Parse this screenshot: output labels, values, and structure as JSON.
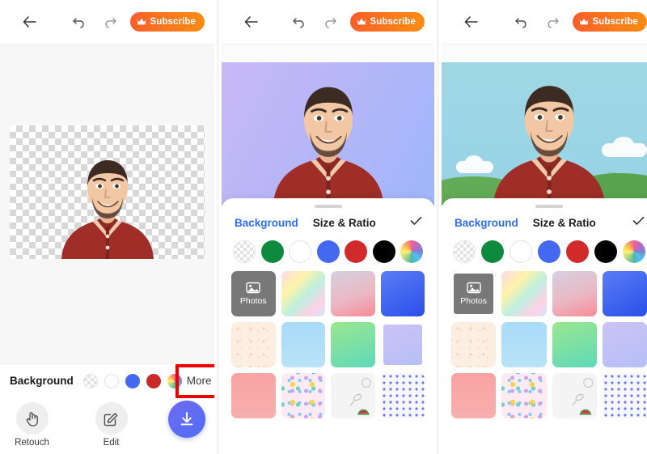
{
  "app": {
    "topbar": {
      "back_icon": "arrow-left-icon",
      "undo_icon": "undo-icon",
      "redo_icon": "redo-icon",
      "subscribe_label": "Subscribe",
      "subscribe_icon": "crown-icon",
      "subscribe_color": "#fb5d29"
    }
  },
  "panel1": {
    "name": "transparent-background-result",
    "background_bar": {
      "label": "Background",
      "more_label": "More",
      "more_highlighted": true,
      "highlight_color": "#ef0000",
      "swatches": [
        {
          "name": "transparent",
          "type": "checker"
        },
        {
          "name": "white",
          "color": "#ffffff"
        },
        {
          "name": "blue",
          "color": "#4469f0"
        },
        {
          "name": "red",
          "color": "#c92a2a"
        },
        {
          "name": "color-wheel",
          "type": "wheel"
        }
      ]
    },
    "actions": [
      {
        "name": "retouch",
        "label": "Retouch",
        "icon": "hand-pointer-icon"
      },
      {
        "name": "edit",
        "label": "Edit",
        "icon": "pencil-square-icon"
      }
    ],
    "download": {
      "name": "download-button",
      "icon": "download-icon",
      "color": "#5468f2"
    }
  },
  "panel2": {
    "name": "purple-gradient-background-applied",
    "sheet": {
      "tabs": [
        {
          "label": "Background",
          "active": true
        },
        {
          "label": "Size & Ratio",
          "active": false
        }
      ],
      "confirm_icon": "check-icon",
      "swatches": [
        {
          "name": "transparent",
          "type": "checker"
        },
        {
          "name": "green",
          "color": "#0d8a3e"
        },
        {
          "name": "white",
          "color": "#ffffff"
        },
        {
          "name": "blue",
          "color": "#4469f0"
        },
        {
          "name": "red",
          "color": "#d12a2a"
        },
        {
          "name": "black",
          "color": "#000000"
        },
        {
          "name": "color-wheel",
          "type": "wheel"
        }
      ],
      "grid": [
        {
          "name": "photos",
          "label": "Photos",
          "icon": "image-icon",
          "kind": "photos",
          "highlighted": false
        },
        {
          "name": "pastel-rainbow",
          "kind": "gradient",
          "css": "linear-gradient(135deg,#ffd9e8 0%,#fff3a8 30%,#bdf0df 55%,#ffd1e6 80%,#cfe9ff 100%)"
        },
        {
          "name": "mauve-pink",
          "kind": "gradient",
          "css": "linear-gradient(160deg,#d6cfe0 0%,#e9b9c4 55%,#f98a96 100%)"
        },
        {
          "name": "royal-blue",
          "kind": "gradient",
          "css": "linear-gradient(150deg,#5b7df7 0%,#2a4fe8 100%)"
        },
        {
          "name": "cream-pattern",
          "kind": "pattern-cream"
        },
        {
          "name": "sky-blue",
          "kind": "gradient",
          "css": "linear-gradient(180deg,#a9dbf8 0%,#b9e3f8 100%)"
        },
        {
          "name": "green-mint",
          "kind": "gradient",
          "css": "linear-gradient(160deg,#9ae78f 0%,#5fd9b9 100%)"
        },
        {
          "name": "lavender-blue",
          "kind": "gradient",
          "css": "linear-gradient(160deg,#cbc3f5 0%,#b6bff6 100%)",
          "highlighted": true
        },
        {
          "name": "coral-pink",
          "kind": "gradient",
          "css": "linear-gradient(180deg,#f9a3a3 0%,#f6b0ad 100%)"
        },
        {
          "name": "confetti-dots",
          "kind": "pattern-dots"
        },
        {
          "name": "watermelon-doodle",
          "kind": "pattern-doodle"
        },
        {
          "name": "blue-dot-grid",
          "kind": "pattern-bluedots"
        }
      ]
    }
  },
  "panel3": {
    "name": "custom-photo-background-applied",
    "sheet": {
      "tabs": [
        {
          "label": "Background",
          "active": true
        },
        {
          "label": "Size & Ratio",
          "active": false
        }
      ],
      "confirm_icon": "check-icon",
      "swatches": [
        {
          "name": "transparent",
          "type": "checker"
        },
        {
          "name": "green",
          "color": "#0d8a3e"
        },
        {
          "name": "white",
          "color": "#ffffff"
        },
        {
          "name": "blue",
          "color": "#4469f0"
        },
        {
          "name": "red",
          "color": "#d12a2a"
        },
        {
          "name": "black",
          "color": "#000000"
        },
        {
          "name": "color-wheel",
          "type": "wheel"
        }
      ],
      "grid": [
        {
          "name": "photos",
          "label": "Photos",
          "icon": "image-icon",
          "kind": "photos",
          "highlighted": true
        },
        {
          "name": "pastel-rainbow",
          "kind": "gradient",
          "css": "linear-gradient(135deg,#ffd9e8 0%,#fff3a8 30%,#bdf0df 55%,#ffd1e6 80%,#cfe9ff 100%)"
        },
        {
          "name": "mauve-pink",
          "kind": "gradient",
          "css": "linear-gradient(160deg,#d6cfe0 0%,#e9b9c4 55%,#f98a96 100%)"
        },
        {
          "name": "royal-blue",
          "kind": "gradient",
          "css": "linear-gradient(150deg,#5b7df7 0%,#2a4fe8 100%)"
        },
        {
          "name": "cream-pattern",
          "kind": "pattern-cream"
        },
        {
          "name": "sky-blue",
          "kind": "gradient",
          "css": "linear-gradient(180deg,#a9dbf8 0%,#b9e3f8 100%)"
        },
        {
          "name": "green-mint",
          "kind": "gradient",
          "css": "linear-gradient(160deg,#9ae78f 0%,#5fd9b9 100%)"
        },
        {
          "name": "lavender-blue",
          "kind": "gradient",
          "css": "linear-gradient(160deg,#cbc3f5 0%,#b6bff6 100%)"
        },
        {
          "name": "coral-pink",
          "kind": "gradient",
          "css": "linear-gradient(180deg,#f9a3a3 0%,#f6b0ad 100%)"
        },
        {
          "name": "confetti-dots",
          "kind": "pattern-dots"
        },
        {
          "name": "watermelon-doodle",
          "kind": "pattern-doodle"
        },
        {
          "name": "blue-dot-grid",
          "kind": "pattern-bluedots"
        }
      ]
    }
  }
}
